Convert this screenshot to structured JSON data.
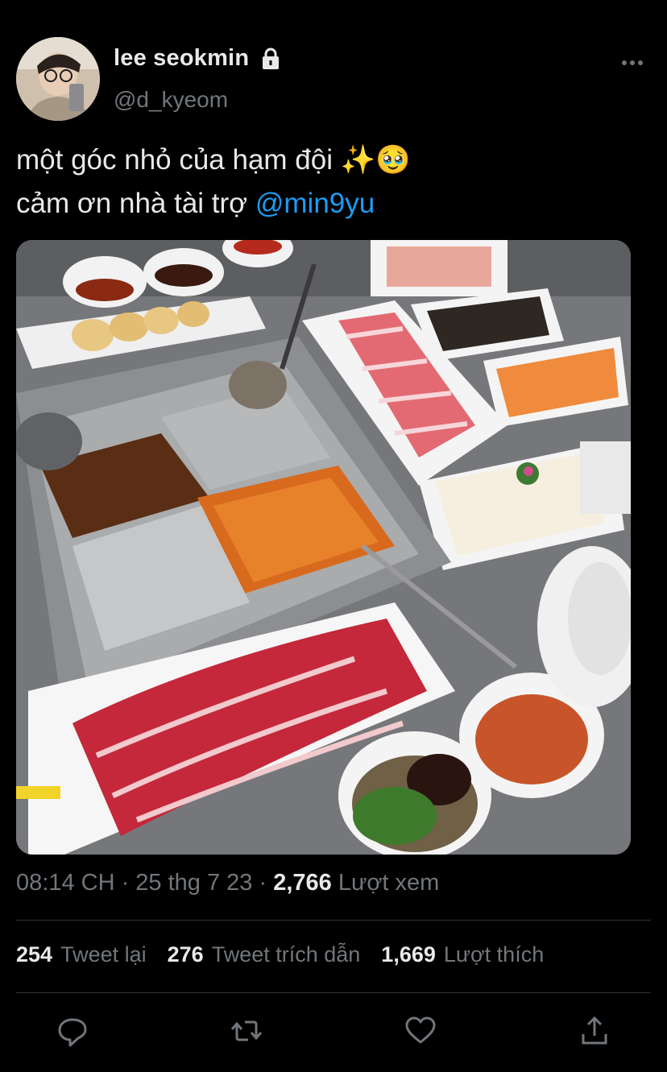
{
  "author": {
    "display_name": "lee seokmin",
    "handle": "@d_kyeom",
    "avatar_icon": "avatar-photo",
    "locked_icon": "lock-icon"
  },
  "tweet": {
    "line1": "một góc nhỏ của hạm đội ✨🥹",
    "line2_prefix": "cảm ơn nhà tài trợ ",
    "mention": "@min9yu"
  },
  "meta": {
    "time": "08:14 CH",
    "sep1": " · ",
    "date": "25 thg 7 23",
    "sep2": " · ",
    "views_count": "2,766",
    "views_label": " Lượt xem"
  },
  "stats": {
    "retweets_count": "254",
    "retweets_label": "Tweet lại",
    "quotes_count": "276",
    "quotes_label": "Tweet trích dẫn",
    "likes_count": "1,669",
    "likes_label": "Lượt thích"
  },
  "actions": [
    "reply-icon",
    "retweet-icon",
    "like-icon",
    "share-icon"
  ],
  "colors": {
    "background": "#000000",
    "accent": "#1d9bf0",
    "secondary_text": "#71767b"
  }
}
